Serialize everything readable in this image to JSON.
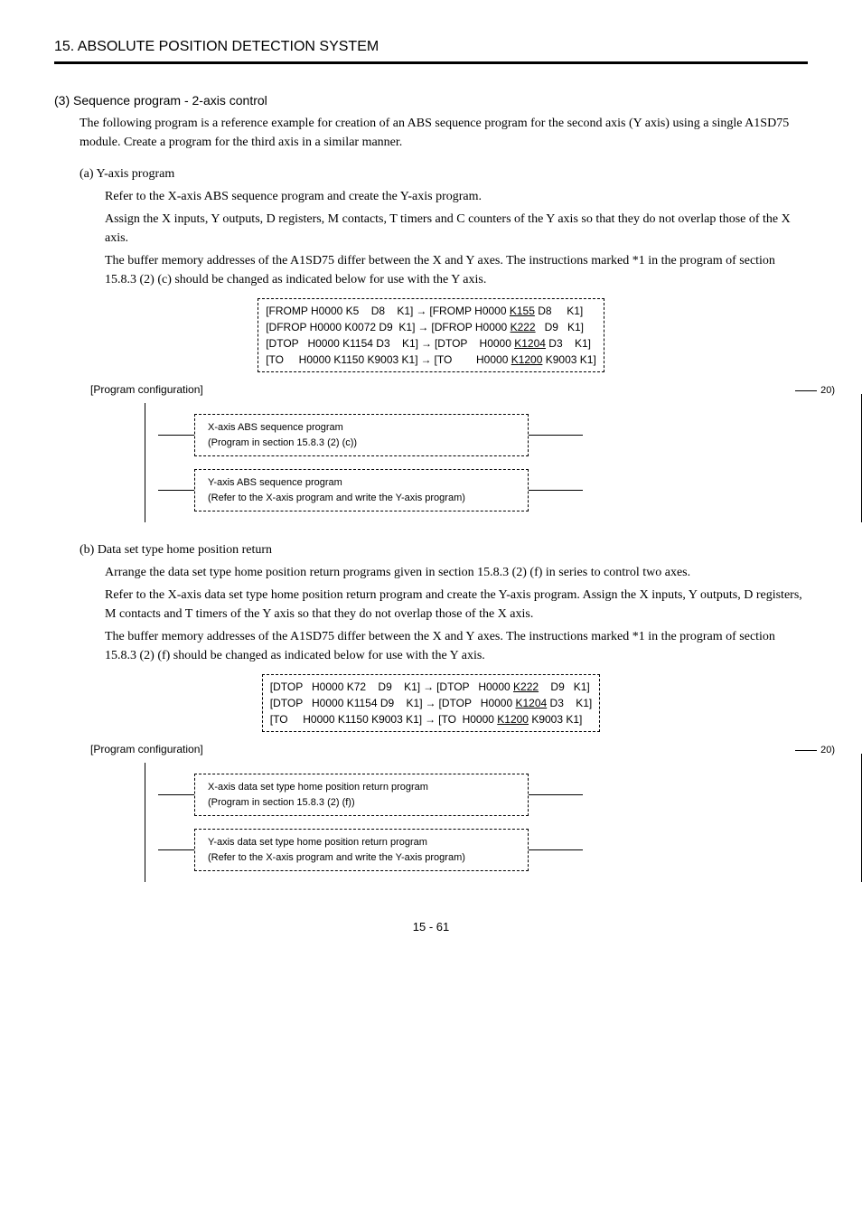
{
  "header": "15. ABSOLUTE POSITION DETECTION SYSTEM",
  "sec3": {
    "title": "(3) Sequence program - 2-axis control",
    "p1": "The following program is a reference example for creation of an ABS sequence program for the second axis (Y axis) using a single A1SD75 module. Create a program for the third axis in a similar manner.",
    "a": {
      "title": "(a) Y-axis program",
      "p1": "Refer to the X-axis ABS sequence program and create the Y-axis program.",
      "p2": "Assign the X inputs, Y outputs, D registers, M contacts, T timers and C counters of the Y axis so that they do not overlap those of the X axis.",
      "p3": "The buffer memory addresses of the A1SD75 differ between the X and Y axes. The instructions marked *1 in the program of section 15.8.3 (2) (c) should be changed as indicated below for use with the Y axis."
    },
    "code_a": {
      "l1_left": "[FROMP H0000 K5    D8    K1]",
      "l1_right_a": "[FROMP H0000 ",
      "l1_right_u": "K155",
      "l1_right_b": " D8     K1]",
      "l2_left": "[DFROP H0000 K0072 D9  K1]",
      "l2_right_a": "[DFROP H0000 ",
      "l2_right_u": "K222",
      "l2_right_b": "   D9   K1]",
      "l3_left": "[DTOP   H0000 K1154 D3    K1]",
      "l3_right_a": "[DTOP    H0000 ",
      "l3_right_u": "K1204",
      "l3_right_b": " D3    K1]",
      "l4_left": "[TO     H0000 K1150 K9003 K1]",
      "l4_right_a": "[TO        H0000 ",
      "l4_right_u": "K1200",
      "l4_right_b": " K9003 K1]"
    },
    "config_label": "[Program configuration]",
    "twenty": "20)",
    "box_a1_l1": "X-axis ABS sequence program",
    "box_a1_l2": "(Program in section 15.8.3 (2) (c))",
    "box_a2_l1": "Y-axis ABS sequence program",
    "box_a2_l2": "(Refer to the X-axis program and write the Y-axis program)",
    "b": {
      "title": "(b) Data set type home position return",
      "p1": "Arrange the data set type home position return programs given in section 15.8.3 (2) (f) in series to control two axes.",
      "p2": "Refer to the X-axis data set type home position return program and create the Y-axis program. Assign the X inputs, Y outputs, D registers, M contacts and T timers of the Y axis so that they do not overlap those of the X axis.",
      "p3": "The buffer memory addresses of the A1SD75 differ between the X and Y axes. The instructions marked *1 in the program of section 15.8.3 (2) (f) should be changed as indicated below for use with the Y axis."
    },
    "code_b": {
      "l1_left": "[DTOP   H0000 K72    D9    K1]",
      "l1_right_a": "[DTOP   H0000 ",
      "l1_right_u": "K222",
      "l1_right_b": "    D9   K1]",
      "l2_left": "[DTOP   H0000 K1154 D9    K1]",
      "l2_right_a": "[DTOP   H0000 ",
      "l2_right_u": "K1204",
      "l2_right_b": " D3    K1]",
      "l3_left": "[TO     H0000 K1150 K9003 K1]",
      "l3_right_a": "[TO  H0000 ",
      "l3_right_u": "K1200",
      "l3_right_b": " K9003 K1]"
    },
    "box_b1_l1": "X-axis data set type home position return program",
    "box_b1_l2": "(Program in section 15.8.3 (2) (f))",
    "box_b2_l1": "Y-axis data set type home position return program",
    "box_b2_l2": "(Refer to the X-axis program and write the Y-axis program)"
  },
  "arrow": "→",
  "page": "15 -  61"
}
